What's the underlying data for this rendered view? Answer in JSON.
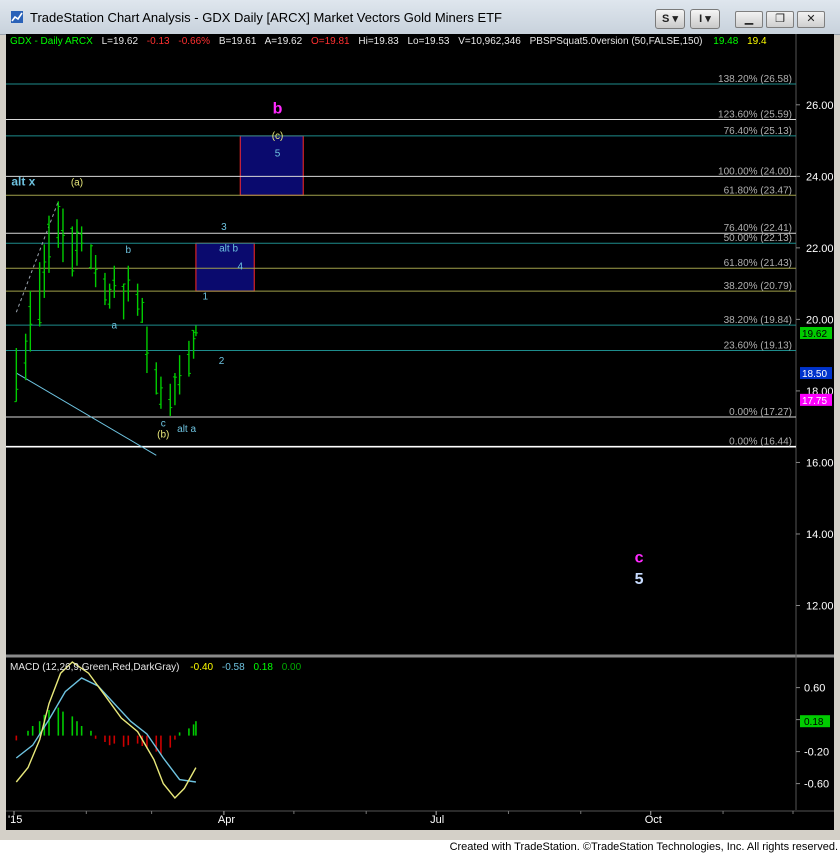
{
  "window": {
    "title": "TradeStation Chart Analysis - GDX Daily [ARCX] Market Vectors Gold Miners ETF",
    "toolbar_buttons": [
      "S",
      "I"
    ],
    "controls": [
      "minimize",
      "restore",
      "close"
    ]
  },
  "footer": {
    "text": "Created with TradeStation. ©TradeStation Technologies, Inc. All rights reserved."
  },
  "price_header": {
    "symbol": "GDX - Daily  ARCX",
    "last": "L=19.62",
    "change": "-0.13",
    "pct": "-0.66%",
    "bid": "B=19.61",
    "ask": "A=19.62",
    "open": "O=19.81",
    "high": "Hi=19.83",
    "low": "Lo=19.53",
    "volume": "V=10,962,346",
    "indicator": "PBSPSquat5.0version (50,FALSE,150)",
    "ind_v1": "19.48",
    "ind_v2": "19.4"
  },
  "macd_header": {
    "name": "MACD (12,26,9,Green,Red,DarkGray)",
    "v1": "-0.40",
    "v2": "-0.58",
    "v3": "0.18",
    "v4": "0.00"
  },
  "chart_data": [
    {
      "type": "candlestick",
      "xlabel": "",
      "ylabel": "",
      "x_ticks": [
        "'15",
        "Apr",
        "Jul",
        "Oct"
      ],
      "y_ticks": [
        12.0,
        14.0,
        16.0,
        18.0,
        20.0,
        22.0,
        24.0,
        26.0
      ],
      "ylim": [
        10.7,
        27.7
      ],
      "grid": false,
      "last_price_tags": [
        {
          "value": "19.62",
          "color": "#00cc00"
        },
        {
          "value": "18.50",
          "color": "#0033cc"
        },
        {
          "value": "17.75",
          "color": "#ff00ff"
        }
      ],
      "price_bars": [
        {
          "date": "2015-01-02",
          "low": 17.7,
          "high": 19.2
        },
        {
          "date": "2015-01-06",
          "low": 18.3,
          "high": 19.6
        },
        {
          "date": "2015-01-08",
          "low": 19.1,
          "high": 20.8
        },
        {
          "date": "2015-01-12",
          "low": 19.8,
          "high": 21.6
        },
        {
          "date": "2015-01-14",
          "low": 20.6,
          "high": 22.1
        },
        {
          "date": "2015-01-16",
          "low": 21.3,
          "high": 22.9
        },
        {
          "date": "2015-01-20",
          "low": 22.0,
          "high": 23.3
        },
        {
          "date": "2015-01-22",
          "low": 21.6,
          "high": 23.1
        },
        {
          "date": "2015-01-26",
          "low": 21.2,
          "high": 22.6
        },
        {
          "date": "2015-01-28",
          "low": 21.5,
          "high": 22.8
        },
        {
          "date": "2015-01-30",
          "low": 21.9,
          "high": 22.6
        },
        {
          "date": "2015-02-03",
          "low": 21.4,
          "high": 22.1
        },
        {
          "date": "2015-02-05",
          "low": 20.9,
          "high": 21.8
        },
        {
          "date": "2015-02-09",
          "low": 20.4,
          "high": 21.3
        },
        {
          "date": "2015-02-11",
          "low": 20.3,
          "high": 21.0
        },
        {
          "date": "2015-02-13",
          "low": 20.6,
          "high": 21.5
        },
        {
          "date": "2015-02-17",
          "low": 20.0,
          "high": 21.0
        },
        {
          "date": "2015-02-19",
          "low": 20.5,
          "high": 21.5
        },
        {
          "date": "2015-02-23",
          "low": 20.1,
          "high": 21.0
        },
        {
          "date": "2015-02-25",
          "low": 19.9,
          "high": 20.6
        },
        {
          "date": "2015-02-27",
          "low": 18.5,
          "high": 19.8
        },
        {
          "date": "2015-03-03",
          "low": 17.9,
          "high": 18.8
        },
        {
          "date": "2015-03-05",
          "low": 17.5,
          "high": 18.4
        },
        {
          "date": "2015-03-09",
          "low": 17.3,
          "high": 18.2
        },
        {
          "date": "2015-03-11",
          "low": 17.6,
          "high": 18.5
        },
        {
          "date": "2015-03-13",
          "low": 17.9,
          "high": 19.0
        },
        {
          "date": "2015-03-17",
          "low": 18.4,
          "high": 19.4
        },
        {
          "date": "2015-03-19",
          "low": 18.9,
          "high": 19.7
        },
        {
          "date": "2015-03-20",
          "low": 19.53,
          "high": 19.83
        }
      ],
      "trendline": {
        "from": {
          "date": "2015-01-02",
          "value": 18.5
        },
        "to": {
          "date": "2015-03-03",
          "value": 16.2
        }
      },
      "fib_lines": [
        {
          "label": "138.20% (26.58)",
          "value": 26.58,
          "color": "#1e8c8c"
        },
        {
          "label": "123.60% (25.59)",
          "value": 25.59,
          "color": "#d8d8d8"
        },
        {
          "label": "76.40% (25.13)",
          "value": 25.13,
          "color": "#1e8c8c"
        },
        {
          "label": "100.00% (24.00)",
          "value": 24.0,
          "color": "#d8d8d8"
        },
        {
          "label": "61.80% (23.47)",
          "value": 23.47,
          "color": "#a0a04a"
        },
        {
          "label": "76.40% (22.41)",
          "value": 22.41,
          "color": "#d8d8d8"
        },
        {
          "label": "50.00% (22.13)",
          "value": 22.13,
          "color": "#1e8c8c"
        },
        {
          "label": "61.80% (21.43)",
          "value": 21.43,
          "color": "#a0a04a"
        },
        {
          "label": "38.20% (20.79)",
          "value": 20.79,
          "color": "#a0a04a"
        },
        {
          "label": "38.20% (19.84)",
          "value": 19.84,
          "color": "#1e8c8c"
        },
        {
          "label": "23.60% (19.13)",
          "value": 19.13,
          "color": "#1e8c8c"
        },
        {
          "label": "0.00% (17.27)",
          "value": 17.27,
          "color": "#d8d8d8"
        },
        {
          "label": "0.00% (16.44)",
          "value": 16.44,
          "color": "#ffffff"
        }
      ],
      "target_boxes": [
        {
          "name": "b",
          "x0": "2015-04-08",
          "x1": "2015-05-05",
          "y_low": 23.47,
          "y_high": 25.13,
          "fill": "#0a0a6e",
          "border": "#ff2a2a"
        },
        {
          "name": "alt b",
          "x0": "2015-03-20",
          "x1": "2015-04-14",
          "y_low": 20.79,
          "y_high": 22.13,
          "fill": "#0a0a6e",
          "border": "#ff2a2a"
        }
      ],
      "annotations": [
        {
          "text": "b",
          "date": "2015-04-24",
          "value": 25.75,
          "color": "#ff2aff"
        },
        {
          "text": "(c)",
          "date": "2015-04-24",
          "value": 25.05,
          "color": "#e8e87a"
        },
        {
          "text": "5",
          "date": "2015-04-24",
          "value": 24.55,
          "color": "#6ec3e0"
        },
        {
          "text": "alt x",
          "date": "2015-01-05",
          "value": 23.75,
          "color": "#6ec3e0"
        },
        {
          "text": "(a)",
          "date": "2015-01-28",
          "value": 23.75,
          "color": "#e8e87a"
        },
        {
          "text": "3",
          "date": "2015-04-01",
          "value": 22.5,
          "color": "#6ec3e0"
        },
        {
          "text": "alt b",
          "date": "2015-04-03",
          "value": 21.9,
          "color": "#6ec3e0"
        },
        {
          "text": "4",
          "date": "2015-04-08",
          "value": 21.4,
          "color": "#6ec3e0"
        },
        {
          "text": "b",
          "date": "2015-02-19",
          "value": 21.85,
          "color": "#6ec3e0"
        },
        {
          "text": "1",
          "date": "2015-03-24",
          "value": 20.55,
          "color": "#6ec3e0"
        },
        {
          "text": "a",
          "date": "2015-02-13",
          "value": 19.75,
          "color": "#6ec3e0"
        },
        {
          "text": "2",
          "date": "2015-03-31",
          "value": 18.75,
          "color": "#6ec3e0"
        },
        {
          "text": "c",
          "date": "2015-03-06",
          "value": 17.0,
          "color": "#6ec3e0"
        },
        {
          "text": "(b)",
          "date": "2015-03-06",
          "value": 16.7,
          "color": "#e8e87a"
        },
        {
          "text": "alt a",
          "date": "2015-03-16",
          "value": 16.85,
          "color": "#6ec3e0"
        },
        {
          "text": "c",
          "date": "2015-09-26",
          "value": 13.2,
          "color": "#ff2aff"
        },
        {
          "text": "5",
          "date": "2015-09-26",
          "value": 12.6,
          "color": "#c8dcff"
        }
      ]
    },
    {
      "type": "bar",
      "name": "MACD (12,26,9,Green,Red,DarkGray)",
      "y_ticks": [
        0.6,
        0.2,
        -0.2,
        -0.6
      ],
      "ylim": [
        -0.88,
        0.92
      ],
      "last_value_tag": "0.18",
      "macd_line": [
        {
          "date": "2015-01-02",
          "value": -0.58
        },
        {
          "date": "2015-01-07",
          "value": -0.4
        },
        {
          "date": "2015-01-12",
          "value": -0.05
        },
        {
          "date": "2015-01-16",
          "value": 0.4
        },
        {
          "date": "2015-01-21",
          "value": 0.78
        },
        {
          "date": "2015-01-26",
          "value": 0.92
        },
        {
          "date": "2015-02-02",
          "value": 0.78
        },
        {
          "date": "2015-02-09",
          "value": 0.5
        },
        {
          "date": "2015-02-16",
          "value": 0.22
        },
        {
          "date": "2015-02-23",
          "value": 0.05
        },
        {
          "date": "2015-03-02",
          "value": -0.3
        },
        {
          "date": "2015-03-06",
          "value": -0.6
        },
        {
          "date": "2015-03-11",
          "value": -0.78
        },
        {
          "date": "2015-03-15",
          "value": -0.66
        },
        {
          "date": "2015-03-20",
          "value": -0.4
        }
      ],
      "signal_line": [
        {
          "date": "2015-01-02",
          "value": -0.28
        },
        {
          "date": "2015-01-09",
          "value": -0.12
        },
        {
          "date": "2015-01-16",
          "value": 0.2
        },
        {
          "date": "2015-01-23",
          "value": 0.55
        },
        {
          "date": "2015-01-30",
          "value": 0.72
        },
        {
          "date": "2015-02-06",
          "value": 0.62
        },
        {
          "date": "2015-02-13",
          "value": 0.4
        },
        {
          "date": "2015-02-20",
          "value": 0.18
        },
        {
          "date": "2015-02-27",
          "value": 0.02
        },
        {
          "date": "2015-03-06",
          "value": -0.28
        },
        {
          "date": "2015-03-13",
          "value": -0.55
        },
        {
          "date": "2015-03-20",
          "value": -0.58
        }
      ],
      "histogram": [
        {
          "date": "2015-01-02",
          "value": -0.06
        },
        {
          "date": "2015-01-05",
          "value": 0.0
        },
        {
          "date": "2015-01-07",
          "value": 0.06
        },
        {
          "date": "2015-01-09",
          "value": 0.12
        },
        {
          "date": "2015-01-12",
          "value": 0.18
        },
        {
          "date": "2015-01-14",
          "value": 0.26
        },
        {
          "date": "2015-01-16",
          "value": 0.32
        },
        {
          "date": "2015-01-20",
          "value": 0.35
        },
        {
          "date": "2015-01-22",
          "value": 0.3
        },
        {
          "date": "2015-01-26",
          "value": 0.24
        },
        {
          "date": "2015-01-28",
          "value": 0.18
        },
        {
          "date": "2015-01-30",
          "value": 0.12
        },
        {
          "date": "2015-02-03",
          "value": 0.06
        },
        {
          "date": "2015-02-05",
          "value": -0.04
        },
        {
          "date": "2015-02-09",
          "value": -0.08
        },
        {
          "date": "2015-02-11",
          "value": -0.12
        },
        {
          "date": "2015-02-13",
          "value": -0.1
        },
        {
          "date": "2015-02-17",
          "value": -0.14
        },
        {
          "date": "2015-02-19",
          "value": -0.12
        },
        {
          "date": "2015-02-23",
          "value": -0.1
        },
        {
          "date": "2015-02-25",
          "value": -0.13
        },
        {
          "date": "2015-02-27",
          "value": -0.16
        },
        {
          "date": "2015-03-03",
          "value": -0.2
        },
        {
          "date": "2015-03-05",
          "value": -0.24
        },
        {
          "date": "2015-03-09",
          "value": -0.15
        },
        {
          "date": "2015-03-11",
          "value": -0.05
        },
        {
          "date": "2015-03-13",
          "value": 0.04
        },
        {
          "date": "2015-03-17",
          "value": 0.09
        },
        {
          "date": "2015-03-19",
          "value": 0.14
        },
        {
          "date": "2015-03-20",
          "value": 0.18
        }
      ]
    }
  ],
  "colors": {
    "background": "#000000",
    "price_bars": "#00cc00",
    "macd_line": "#e8e87a",
    "signal_line": "#6ec3e0",
    "hist_up": "#00cc00",
    "hist_down": "#cc0000",
    "axis_text": "#ffffff",
    "fib_label_gray": "#b0b0b0"
  }
}
